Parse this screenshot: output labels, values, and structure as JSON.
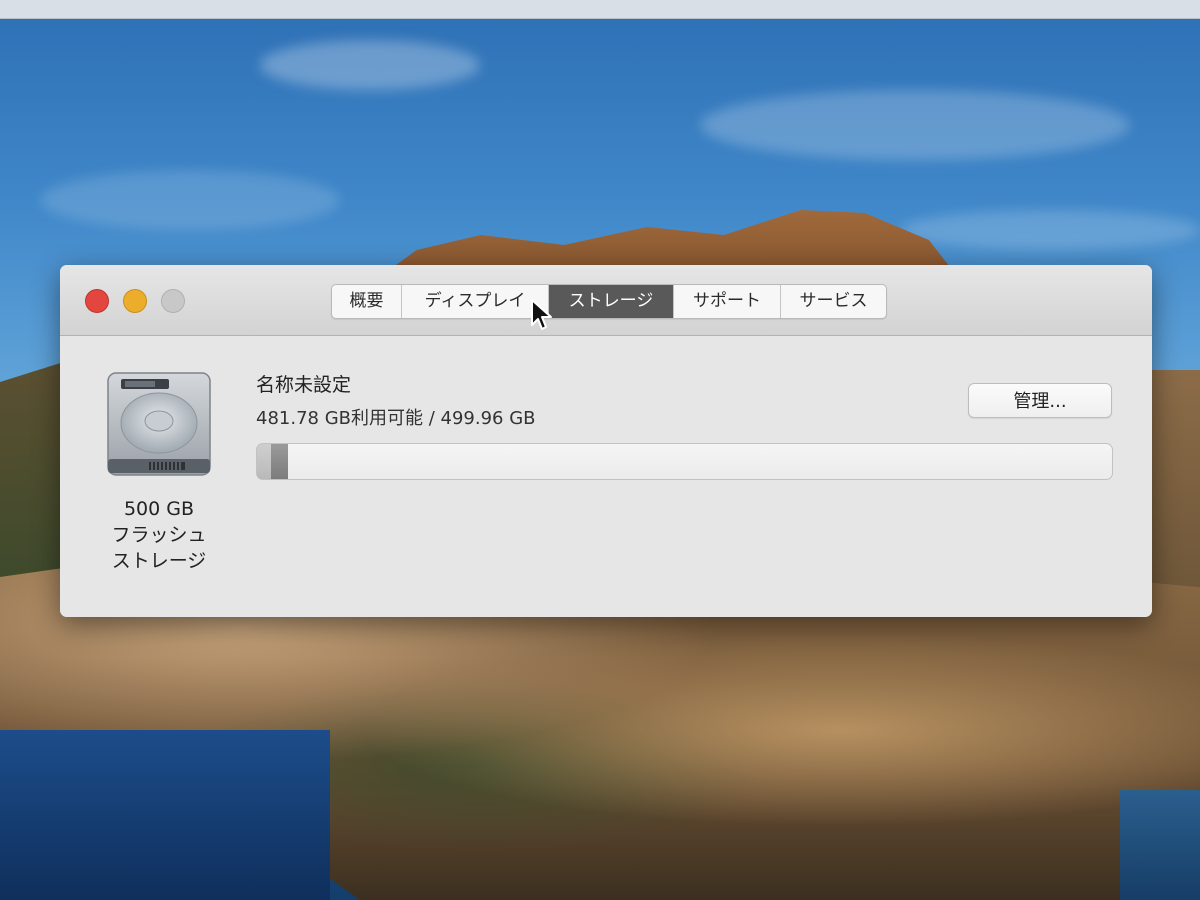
{
  "window": {
    "tabs": [
      {
        "label": "概要",
        "active": false
      },
      {
        "label": "ディスプレイ",
        "active": false
      },
      {
        "label": "ストレージ",
        "active": true
      },
      {
        "label": "サポート",
        "active": false
      },
      {
        "label": "サービス",
        "active": false
      }
    ]
  },
  "storage": {
    "volume_name": "名称未設定",
    "usage_text": "481.78 GB利用可能 / 499.96 GB",
    "manage_label": "管理...",
    "used_fraction": 0.036,
    "disk_caption": [
      "500 GB",
      "フラッシュ",
      "ストレージ"
    ]
  },
  "colors": {
    "close": "#e2463f",
    "minimize": "#ecae2a",
    "maximize": "#c8c8c8",
    "active_tab": "#595959"
  },
  "icons": {
    "disk": "hard-drive-icon",
    "cursor": "mouse-pointer-icon"
  }
}
